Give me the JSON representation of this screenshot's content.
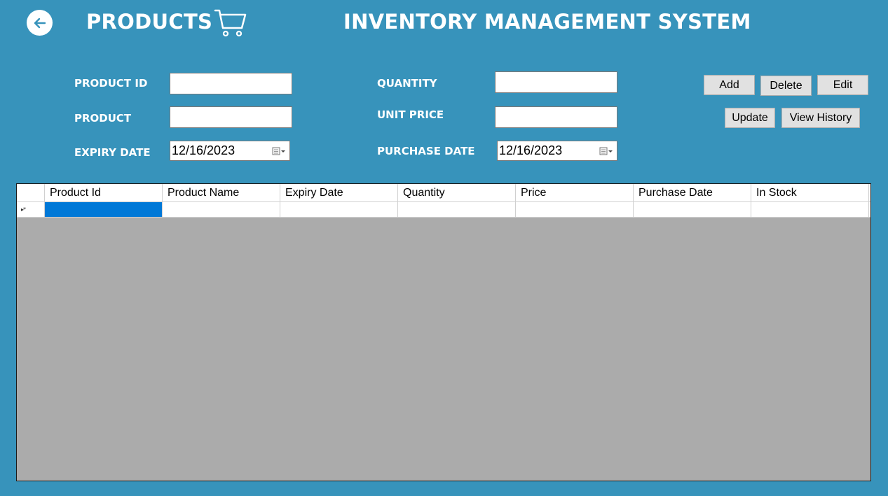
{
  "header": {
    "page_title": "PRODUCTS",
    "app_title": "INVENTORY MANAGEMENT SYSTEM",
    "back_icon": "arrow-left-icon",
    "cart_icon": "shopping-cart-icon"
  },
  "form": {
    "product_id_label": "PRODUCT ID",
    "product_label": "PRODUCT",
    "expiry_date_label": "EXPIRY DATE",
    "quantity_label": "QUANTITY",
    "unit_price_label": "UNIT PRICE",
    "purchase_date_label": "PURCHASE DATE",
    "product_id_value": "",
    "product_value": "",
    "quantity_value": "",
    "unit_price_value": "",
    "expiry_date_value": "12/16/2023",
    "purchase_date_value": "12/16/2023"
  },
  "buttons": {
    "add": "Add",
    "delete": "Delete",
    "edit": "Edit",
    "update": "Update",
    "view_history": "View History"
  },
  "grid": {
    "columns": [
      "Product Id",
      "Product Name",
      "Expiry Date",
      "Quantity",
      "Price",
      "Purchase Date",
      "In Stock"
    ],
    "new_row_marker": "▸*"
  },
  "colors": {
    "background": "#3793bb",
    "selected_cell": "#0078d7",
    "grid_empty": "#ababab"
  }
}
